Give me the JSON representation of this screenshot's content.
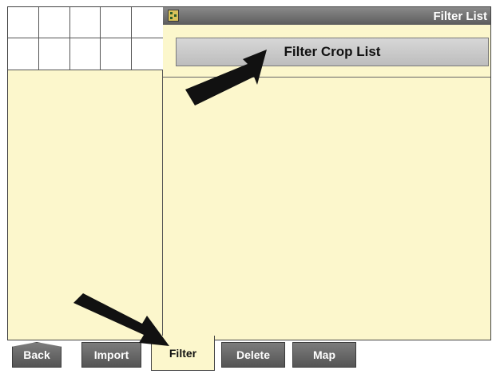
{
  "title_bar": {
    "title": "Filter List",
    "icon": "app-icon"
  },
  "main": {
    "filter_button_label": "Filter Crop List"
  },
  "softkeys": [
    {
      "label": "Back",
      "active": false
    },
    {
      "label": "Import",
      "active": false
    },
    {
      "label": "Filter",
      "active": true
    },
    {
      "label": "Delete",
      "active": false
    },
    {
      "label": "Map",
      "active": false
    }
  ],
  "colors": {
    "panel": "#fcf7cc",
    "titlebar": "#6f6f6f",
    "button": "#c8c8c8"
  }
}
